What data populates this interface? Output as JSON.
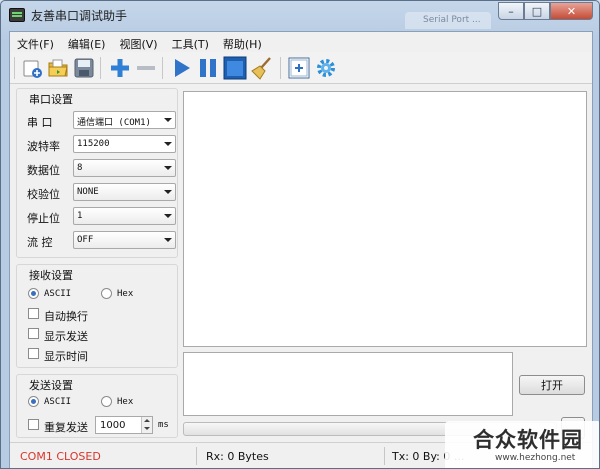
{
  "window": {
    "title": "友善串口调试助手",
    "background_tab": "Serial Port ...",
    "controls": {
      "minimize": "–",
      "maximize": "□",
      "close": "✕"
    }
  },
  "menu": [
    "文件(F)",
    "编辑(E)",
    "视图(V)",
    "工具(T)",
    "帮助(H)"
  ],
  "toolbar": {
    "icons": [
      "new-file-icon",
      "open-folder-icon",
      "save-icon",
      "add-icon",
      "remove-icon",
      "play-icon",
      "pause-icon",
      "window-icon",
      "broom-clear-icon",
      "add-frame-icon",
      "gear-icon"
    ]
  },
  "serial_settings": {
    "title": "串口设置",
    "rows": [
      {
        "label": "串  口",
        "value": "通信端口 (COM1)"
      },
      {
        "label": "波特率",
        "value": "115200"
      },
      {
        "label": "数据位",
        "value": "8"
      },
      {
        "label": "校验位",
        "value": "NONE"
      },
      {
        "label": "停止位",
        "value": "1"
      },
      {
        "label": "流  控",
        "value": "OFF"
      }
    ]
  },
  "receive_settings": {
    "title": "接收设置",
    "mode_ascii": "ASCII",
    "mode_hex": "Hex",
    "selected_mode": "ASCII",
    "options": [
      "自动换行",
      "显示发送",
      "显示时间"
    ]
  },
  "send_settings": {
    "title": "发送设置",
    "mode_ascii": "ASCII",
    "mode_hex": "Hex",
    "selected_mode": "ASCII",
    "repeat_label": "重复发送",
    "repeat_interval": "1000",
    "unit": "ms"
  },
  "buttons": {
    "open": "打开"
  },
  "status": {
    "port": "COM1 CLOSED",
    "port_color": "#d8352a",
    "rx": "Rx: 0 Bytes",
    "tx": "Tx: 0 By: 0 ..."
  },
  "watermark": {
    "title": "合众软件园",
    "url": "www.hezhong.net"
  }
}
